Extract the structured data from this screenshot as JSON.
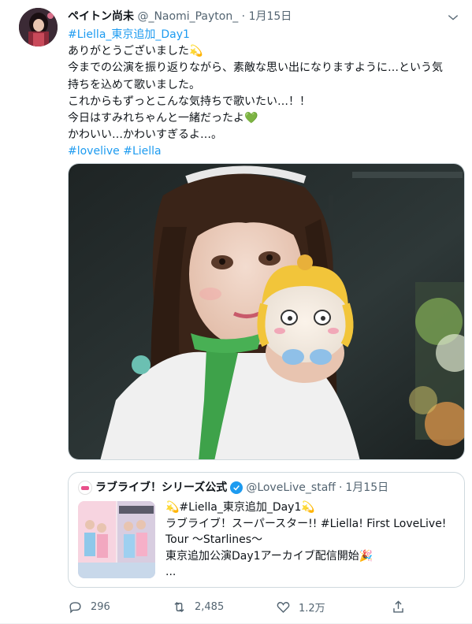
{
  "tweet": {
    "display_name": "ペイトン尚未",
    "handle": "@_Naomi_Payton_",
    "separator": "·",
    "date": "1月15日",
    "lines": [
      {
        "type": "tag",
        "text": "#Liella_東京追加_Day1"
      },
      {
        "type": "text",
        "text": "ありがとうございました💫"
      },
      {
        "type": "text",
        "text": "今までの公演を振り返りながら、素敵な思い出になりますように…という気"
      },
      {
        "type": "text",
        "text": "持ちを込めて歌いました。"
      },
      {
        "type": "text",
        "text": "これからもずっとこんな気持ちで歌いたい…！！"
      },
      {
        "type": "text",
        "text": "今日はすみれちゃんと一緒だったよ💚"
      },
      {
        "type": "text",
        "text": "かわいい…かわいすぎるよ…。"
      }
    ],
    "tags_line": [
      "#lovelive",
      "#Liella"
    ]
  },
  "quote": {
    "display_name": "ラブライブ！シリーズ公式",
    "handle": "@LoveLive_staff",
    "separator": "·",
    "date": "1月15日",
    "lines": [
      "💫#Liella_東京追加_Day1💫",
      "ラブライブ！スーパースター!! #Liella! First LoveLive!",
      "Tour ～Starlines～",
      "東京追加公演Day1アーカイブ配信開始🎉",
      "..."
    ]
  },
  "actions": {
    "replies": "296",
    "retweets": "2,485",
    "likes": "1.2万"
  },
  "icons": {
    "caret": "chevron-down-icon",
    "reply": "reply-icon",
    "retweet": "retweet-icon",
    "like": "heart-icon",
    "share": "share-icon",
    "verified": "verified-badge-icon"
  },
  "colors": {
    "link": "#1d9bf0",
    "secondary_text": "#536471",
    "border": "#cfd9de"
  }
}
